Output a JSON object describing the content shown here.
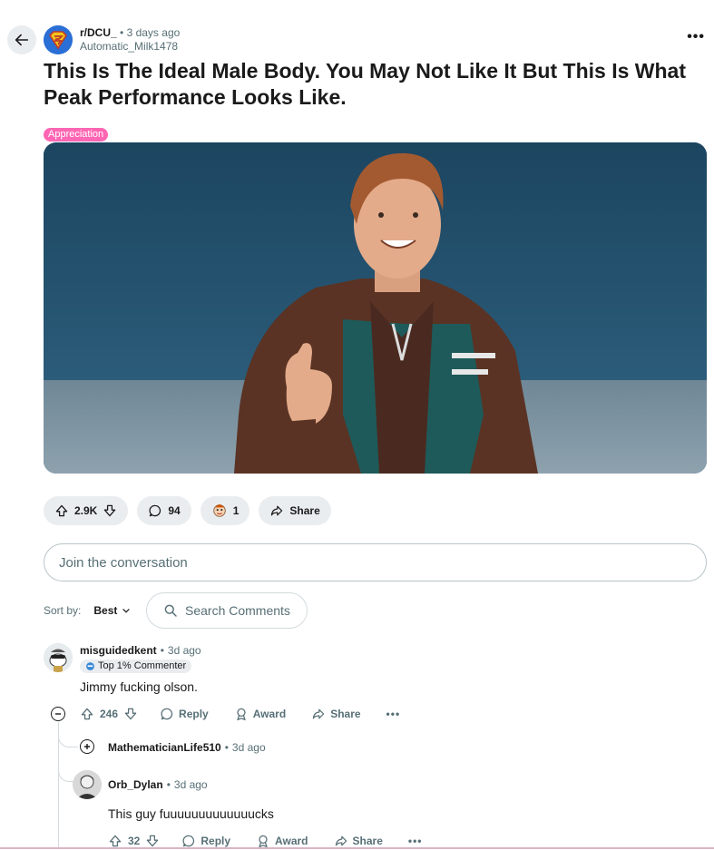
{
  "post": {
    "subreddit": "r/DCU_",
    "separator": "•",
    "time": "3 days ago",
    "author": "Automatic_Milk1478",
    "title": "This Is The Ideal Male Body. You May Not Like It But This Is What Peak Performance Looks Like.",
    "flair": "Appreciation",
    "more": "•••"
  },
  "actions": {
    "votes": "2.9K",
    "comments": "94",
    "awards": "1",
    "share": "Share"
  },
  "composer": {
    "placeholder": "Join the conversation"
  },
  "sort": {
    "label": "Sort by:",
    "value": "Best"
  },
  "search": {
    "placeholder": "Search Comments"
  },
  "comments": [
    {
      "author": "misguidedkent",
      "time": "3d ago",
      "badge": "Top 1% Commenter",
      "body": "Jimmy fucking olson.",
      "votes": "246",
      "reply": "Reply",
      "award": "Award",
      "share": "Share",
      "more": "•••"
    },
    {
      "author": "MathematicianLife510",
      "time": "3d ago"
    },
    {
      "author": "Orb_Dylan",
      "time": "3d ago",
      "body": "This guy fuuuuuuuuuuuuucks",
      "votes": "32",
      "reply": "Reply",
      "award": "Award",
      "share": "Share",
      "more": "•••"
    }
  ],
  "colors": {
    "flair": "#ff66b3",
    "pill_bg": "#eaedef",
    "muted_text": "#576f76",
    "image_bg": "#1e4a66"
  }
}
